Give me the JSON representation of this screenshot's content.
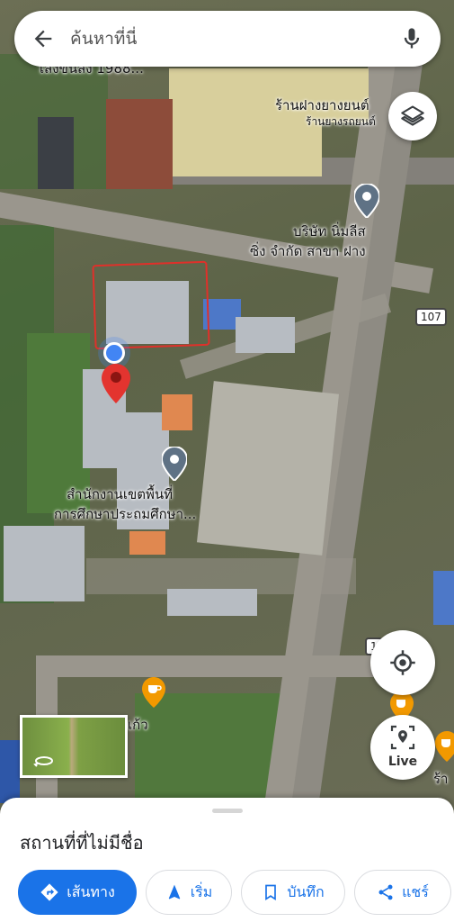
{
  "search": {
    "placeholder": "ค้นหาที่นี่"
  },
  "map": {
    "labels": {
      "top_left": "เสงขนสง 1988...",
      "tire_shop_line1": "ร้านฝางยางยนต์",
      "tire_shop_line2": "ร้านยางรถยนต์",
      "company_line1": "บริษัท นิ่มลีส",
      "company_line2": "ซิ่ง จำกัด สาขา ฝาง",
      "office_line1": "สำนักงานเขตพื้นที่",
      "office_line2": "การศึกษาประถมศึกษา...",
      "cafe_label": "เก้ว",
      "right_cafe_label": "ร้า",
      "route_number": "107",
      "route_number_lower": "1"
    },
    "icons": {
      "poi_pin": "grey-place-pin-icon",
      "cafe_pin": "cafe-icon",
      "dropped_pin": "red-dropped-pin-icon",
      "blue_dot": "current-location-dot-icon"
    },
    "colors": {
      "dropped_pin": "#e3342f",
      "annotation_box": "#e0302a",
      "cafe_pin": "#f29900"
    }
  },
  "controls": {
    "layers_icon": "layers-icon",
    "locate_icon": "my-location-icon",
    "live_label": "Live"
  },
  "sheet": {
    "title": "สถานที่ที่ไม่มีชื่อ",
    "actions": {
      "directions": "เส้นทาง",
      "start": "เริ่ม",
      "save": "บันทึก",
      "share": "แชร์"
    },
    "accent": "#1a73e8"
  }
}
